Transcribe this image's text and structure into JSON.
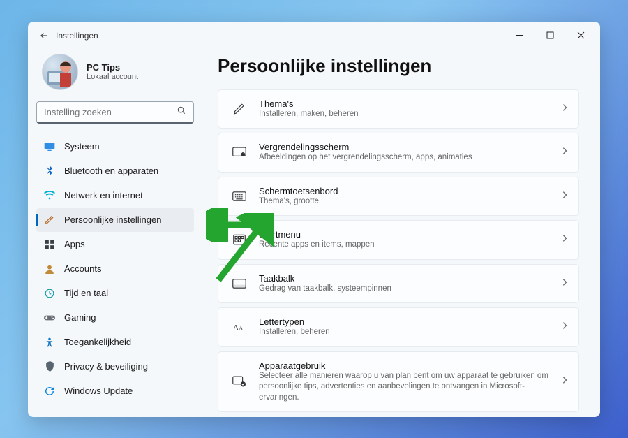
{
  "window": {
    "title": "Instellingen"
  },
  "profile": {
    "name": "PC Tips",
    "sub": "Lokaal account"
  },
  "search": {
    "placeholder": "Instelling zoeken"
  },
  "nav": {
    "items": [
      {
        "id": "system",
        "label": "Systeem"
      },
      {
        "id": "bluetooth",
        "label": "Bluetooth en apparaten"
      },
      {
        "id": "network",
        "label": "Netwerk en internet"
      },
      {
        "id": "personal",
        "label": "Persoonlijke instellingen"
      },
      {
        "id": "apps",
        "label": "Apps"
      },
      {
        "id": "accounts",
        "label": "Accounts"
      },
      {
        "id": "time",
        "label": "Tijd en taal"
      },
      {
        "id": "gaming",
        "label": "Gaming"
      },
      {
        "id": "access",
        "label": "Toegankelijkheid"
      },
      {
        "id": "privacy",
        "label": "Privacy & beveiliging"
      },
      {
        "id": "update",
        "label": "Windows Update"
      }
    ],
    "active": "personal"
  },
  "page": {
    "title": "Persoonlijke instellingen"
  },
  "cards": [
    {
      "id": "themes",
      "title": "Thema's",
      "sub": "Installeren, maken, beheren"
    },
    {
      "id": "lock",
      "title": "Vergrendelingsscherm",
      "sub": "Afbeeldingen op het vergrendelingsscherm, apps, animaties"
    },
    {
      "id": "touchkb",
      "title": "Schermtoetsenbord",
      "sub": "Thema's, grootte"
    },
    {
      "id": "start",
      "title": "Startmenu",
      "sub": "Recente apps en items, mappen"
    },
    {
      "id": "taskbar",
      "title": "Taakbalk",
      "sub": "Gedrag van taakbalk, systeempinnen"
    },
    {
      "id": "fonts",
      "title": "Lettertypen",
      "sub": "Installeren, beheren"
    },
    {
      "id": "usage",
      "title": "Apparaatgebruik",
      "sub": "Selecteer alle manieren waarop u van plan bent om uw apparaat te gebruiken om persoonlijke tips, advertenties en aanbevelingen te ontvangen in Microsoft-ervaringen."
    }
  ],
  "icons": {
    "system": "#2f8de4",
    "bluetooth": "#0a64c2",
    "network": "#00b0d8",
    "personal": "#b96b26",
    "apps": "#3a3f47",
    "accounts": "#c08a3a",
    "time": "#1699a6",
    "gaming": "#6a6f76",
    "access": "#1576c4",
    "privacy": "#5a6470",
    "update": "#0a84d8"
  },
  "annotation_color": "#23a52f"
}
